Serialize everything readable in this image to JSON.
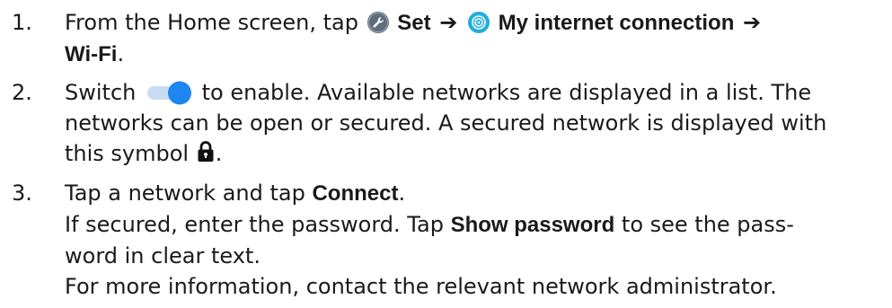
{
  "steps": [
    {
      "number": "1.",
      "line1_text1": "From the Home screen, tap",
      "set_label": "Set",
      "internet_label": "My internet connection",
      "wifi_label": "Wi-Fi",
      "period": ".",
      "icons": [
        "settings-wrench-icon",
        "internet-connection-icon",
        "right-arrow-icon"
      ]
    },
    {
      "number": "2.",
      "line1_prefix": "Switch",
      "line1_suffix": "to enable. Available networks are displayed in a list. The",
      "line2": "networks can be open or secured. A secured network is displayed with",
      "line3_prefix": "this symbol",
      "line3_suffix": ".",
      "icons": [
        "toggle-switch-icon",
        "lock-icon"
      ]
    },
    {
      "number": "3.",
      "line1_prefix": "Tap a network and tap",
      "connect_label": "Connect",
      "line1_suffix": ".",
      "line2_prefix": "If secured, enter the password. Tap",
      "show_password_label": "Show password",
      "line2_suffix": "to see the pass-",
      "line3": "word in clear text.",
      "line4": "For more information, contact the relevant network administrator."
    }
  ],
  "colors": {
    "text": "#1a1a1a",
    "toggle_track": "#c9dcf3",
    "toggle_knob": "#1e86f0",
    "settings_icon_bg": "#5e6e7e",
    "internet_icon_bg": "#20aee0"
  }
}
